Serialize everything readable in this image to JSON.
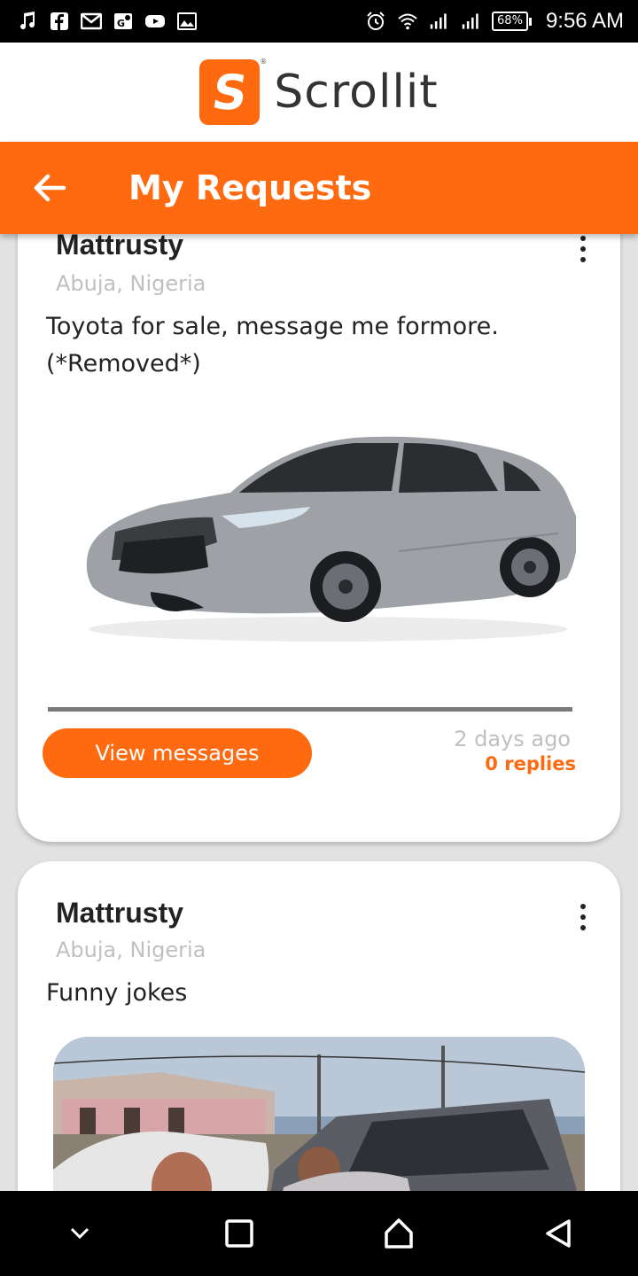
{
  "status_bar": {
    "left_icons": [
      "music-icon",
      "facebook-icon",
      "gmail-icon",
      "maps-icon",
      "youtube-icon",
      "gallery-icon"
    ],
    "battery": "68%",
    "time": "9:56 AM"
  },
  "app": {
    "logo_letter": "S",
    "name": "Scrollit"
  },
  "toolbar": {
    "title": "My Requests"
  },
  "posts": [
    {
      "user": "Mattrusty",
      "location": "Abuja, Nigeria",
      "text": "Toyota for sale, message me formore. (*Removed*)",
      "image": "car-photo",
      "button": "View messages",
      "time_ago": "2 days ago",
      "replies": "0 replies"
    },
    {
      "user": "Mattrusty",
      "location": "Abuja, Nigeria",
      "text": "Funny jokes",
      "image": "street-photo"
    }
  ],
  "colors": {
    "accent": "#ff6a10",
    "muted": "#c0c0c0",
    "status_bar": "#000000"
  }
}
